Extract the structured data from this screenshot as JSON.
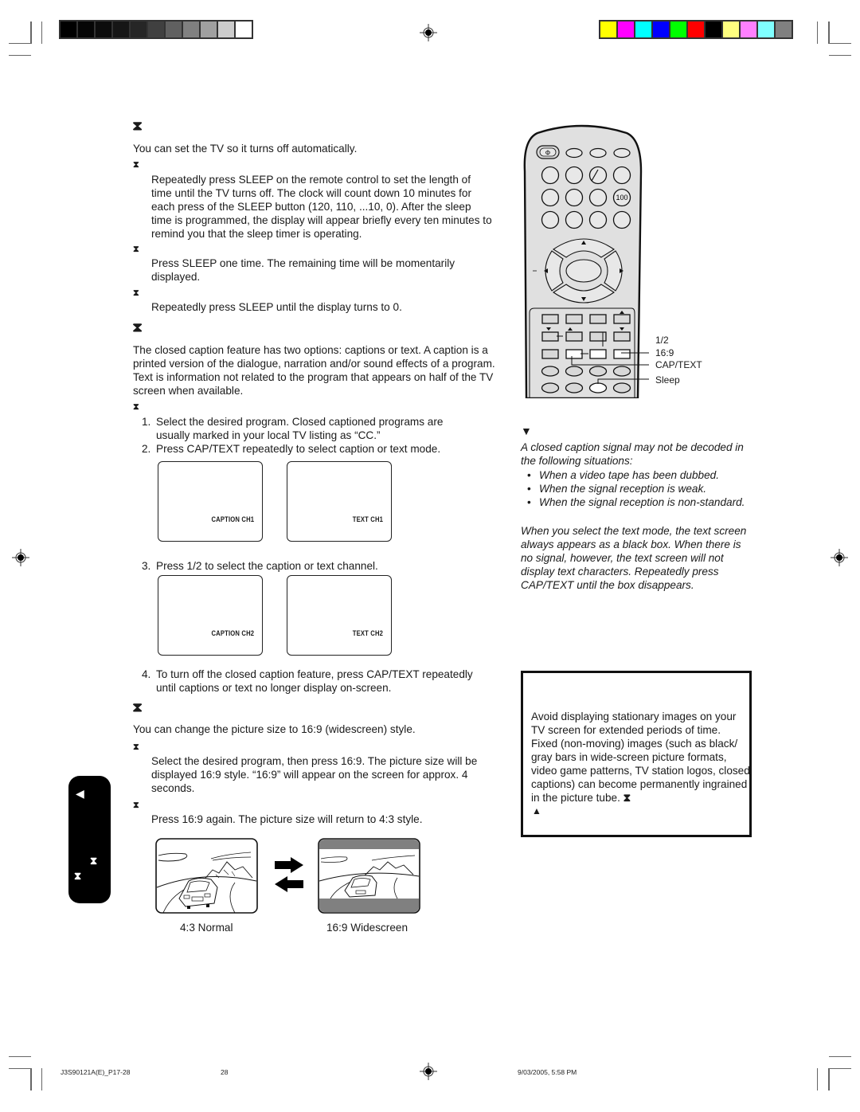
{
  "page": {
    "number": "28",
    "footer_file": "J3S90121A(E)_P17-28",
    "footer_timestamp": "9/03/2005, 5:58 PM"
  },
  "print_marks": {
    "grayscale_bar": [
      "#000000",
      "#050505",
      "#0c0c0c",
      "#161616",
      "#262626",
      "#404040",
      "#606060",
      "#808080",
      "#a0a0a0",
      "#cccccc",
      "#ffffff"
    ],
    "color_bar": [
      "#ffff00",
      "#ff00ff",
      "#00ffff",
      "#0000ff",
      "#00ff00",
      "#ff0000",
      "#000000",
      "#ffff80",
      "#ff80ff",
      "#80ffff",
      "#808080"
    ]
  },
  "sleep_timer": {
    "heading_glyph": "⧗",
    "intro": "You can set the TV so it turns off automatically.",
    "steps": [
      {
        "glyph": "⧗",
        "text": "Repeatedly press SLEEP on the remote control to set the length of time until the TV turns off. The clock will count down 10 minutes for each press of the SLEEP button (120, 110, ...10, 0). After the sleep time is programmed, the display will appear briefly every ten minutes to remind you that the sleep timer is operating."
      },
      {
        "glyph": "⧗",
        "text": "Press SLEEP one time. The remaining time will be momentarily displayed."
      },
      {
        "glyph": "⧗",
        "text": "Repeatedly press SLEEP until the display turns to 0."
      }
    ]
  },
  "closed_caption": {
    "heading_glyph": "⧗",
    "intro": "The closed caption feature has two options: captions or text. A caption is a printed version of the dialogue, narration and/or sound effects of a program. Text is information not related to the program that appears on half of the TV screen when available.",
    "sub_glyph": "⧗",
    "steps": [
      {
        "num": "1.",
        "text": "Select the desired program. Closed captioned programs are usually marked in your local TV listing as “CC.”"
      },
      {
        "num": "2.",
        "text": "Press CAP/TEXT repeatedly to select caption or text mode."
      },
      {
        "num": "3.",
        "text": "Press 1/2 to select the caption or text channel."
      },
      {
        "num": "4.",
        "text": "To turn off the closed caption feature, press CAP/TEXT repeatedly until captions or text no longer display on-screen."
      }
    ],
    "screens_row1": [
      "CAPTION CH1",
      "TEXT CH1"
    ],
    "screens_row2": [
      "CAPTION CH2",
      "TEXT CH2"
    ]
  },
  "picture_size": {
    "heading_glyph": "⧗",
    "intro": "You can change the picture size to 16:9 (widescreen) style.",
    "steps": [
      {
        "glyph": "⧗",
        "text": "Select the desired program, then press 16:9. The picture size will be displayed 16:9 style. “16:9” will appear on the screen for approx. 4 seconds."
      },
      {
        "glyph": "⧗",
        "text": "Press 16:9 again. The picture size will return to 4:3 style."
      }
    ],
    "image_labels": [
      "4:3 Normal",
      "16:9 Widescreen"
    ]
  },
  "remote": {
    "callouts": [
      "1/2",
      "16:9",
      "CAP/TEXT",
      "Sleep"
    ],
    "key_100": "100",
    "power_glyph": "Φ"
  },
  "note": {
    "glyph": "▼",
    "intro": "A closed caption signal may not be decoded in the following situations:",
    "bullets": [
      "When a video tape has been dubbed.",
      "When the signal reception is weak.",
      "When the signal reception is non-standard."
    ],
    "text_mode": "When you select the text mode, the text screen always appears as a black box. When there is no signal, however, the text screen will not display text characters. Repeatedly press CAP/TEXT until the box disappears."
  },
  "warning_box": {
    "text": "Avoid displaying stationary images on your TV screen for extended periods of time. Fixed (non-moving) images (such as black/ gray bars in wide-screen picture formats, video game patterns, TV station logos, closed captions) can become permanently ingrained in the picture tube.",
    "trailing_glyph": "⧗",
    "triangle_glyph": "▲"
  },
  "side_tab": {
    "glyphs": [
      "◀",
      "⧗",
      "⧗"
    ]
  }
}
